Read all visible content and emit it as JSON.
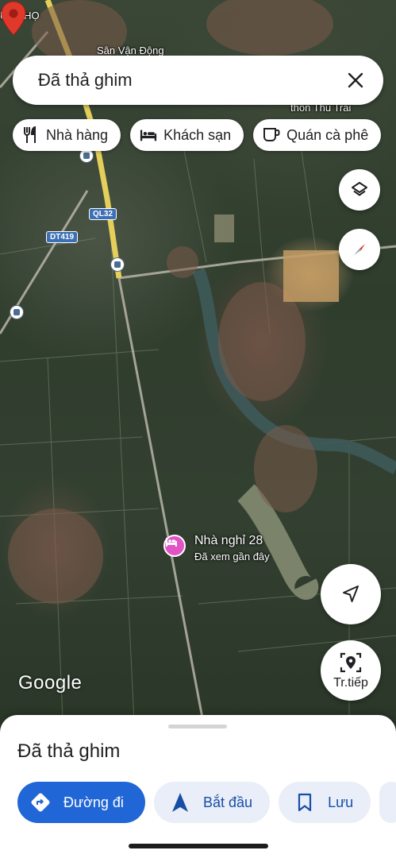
{
  "map": {
    "labels": {
      "top_left": "ÚC THỌ",
      "stadium": "Sân Vận Động",
      "village": "thôn Thú Trai"
    },
    "road_shields": {
      "ql32": "QL32",
      "dt419": "DT419"
    },
    "place": {
      "name": "Nhà nghỉ 28",
      "subtitle": "Đã xem gần đây"
    },
    "google_logo": "Google"
  },
  "search": {
    "title": "Đã thả ghim"
  },
  "chips": [
    {
      "label": "Nhà hàng",
      "icon": "restaurant-icon"
    },
    {
      "label": "Khách sạn",
      "icon": "hotel-icon"
    },
    {
      "label": "Quán cà phê",
      "icon": "coffee-icon"
    }
  ],
  "controls": {
    "live_label": "Tr.tiếp"
  },
  "sheet": {
    "title": "Đã thả ghim",
    "actions": [
      {
        "label": "Đường đi",
        "icon": "directions-icon"
      },
      {
        "label": "Bắt đầu",
        "icon": "navigation-arrow-icon"
      },
      {
        "label": "Lưu",
        "icon": "bookmark-icon"
      }
    ]
  },
  "colors": {
    "accent": "#2166d6",
    "secondary_button": "#e9eef8",
    "pin": "#e0392b",
    "hotel_marker": "#e253c5"
  }
}
